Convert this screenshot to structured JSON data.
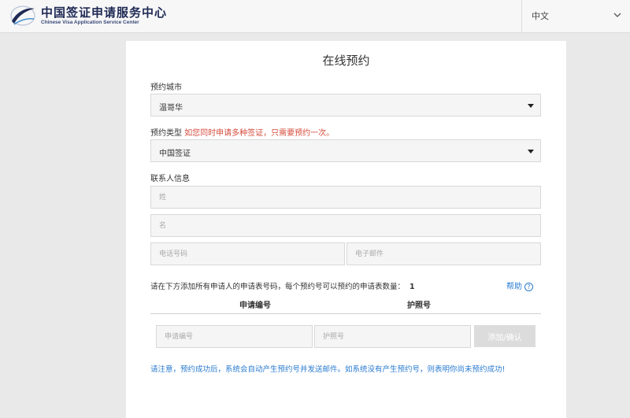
{
  "header": {
    "brand_cn": "中国签证申请服务中心",
    "brand_en": "Chinese Visa Application Service Center",
    "logo_icon": "globe-swoosh-icon",
    "language": "中文",
    "accent_color": "#1f2a55"
  },
  "form": {
    "title": "在线预约",
    "city_label": "预约城市",
    "city_value": "温哥华",
    "type_label": "预约类型",
    "type_note": "如您同时申请多种签证，只需要预约一次。",
    "type_value": "中国签证",
    "contact_label": "联系人信息",
    "surname_placeholder": "姓",
    "given_name_placeholder": "名",
    "phone_placeholder": "电话号码",
    "email_placeholder": "电子邮件",
    "instruction": "请在下方添加所有申请人的申请表号码，每个预约号可以预约的申请表数量：",
    "max_count": "1",
    "help_label": "帮助",
    "help_icon_glyph": "?",
    "col_application": "申请编号",
    "col_passport": "护照号",
    "application_placeholder": "申请编号",
    "passport_placeholder": "护照号",
    "add_button": "添加/确认",
    "notice": "请注意，预约成功后，系统会自动产生预约号并发送邮件。如系统没有产生预约号，则表明你尚未预约成功!",
    "note_color": "#d64b3c",
    "link_color": "#2a7bd0"
  }
}
